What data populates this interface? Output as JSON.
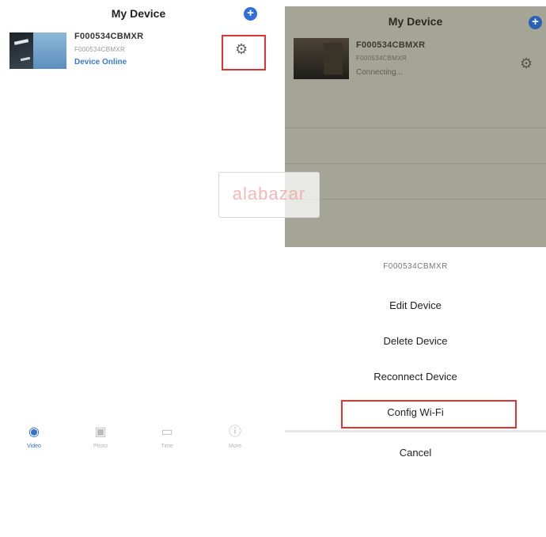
{
  "left_screen": {
    "title": "My Device",
    "add_icon": "plus-circle-icon",
    "device": {
      "name": "F000534CBMXR",
      "id": "F000534CBMXR",
      "status": "Device Online"
    },
    "gear_icon": "gear-icon",
    "highlight_color": "#e03434",
    "tabs": [
      {
        "label": "Video",
        "icon": "camera-icon",
        "active": true
      },
      {
        "label": "Photo",
        "icon": "image-icon",
        "active": false
      },
      {
        "label": "Time",
        "icon": "video-icon",
        "active": false
      },
      {
        "label": "More",
        "icon": "info-icon",
        "active": false
      }
    ]
  },
  "watermark": {
    "text": "alabazar"
  },
  "right_screen": {
    "title": "My Device",
    "device": {
      "name": "F000534CBMXR",
      "id": "F000534CBMXR",
      "status": "Connecting..."
    },
    "action_sheet": {
      "header": "F000534CBMXR",
      "items": [
        "Edit Device",
        "Delete Device",
        "Reconnect Device",
        "Config Wi-Fi"
      ],
      "cancel": "Cancel"
    }
  },
  "colors": {
    "accent": "#2f6fd6",
    "highlight": "#e03434",
    "overlay": "#a4a596"
  }
}
